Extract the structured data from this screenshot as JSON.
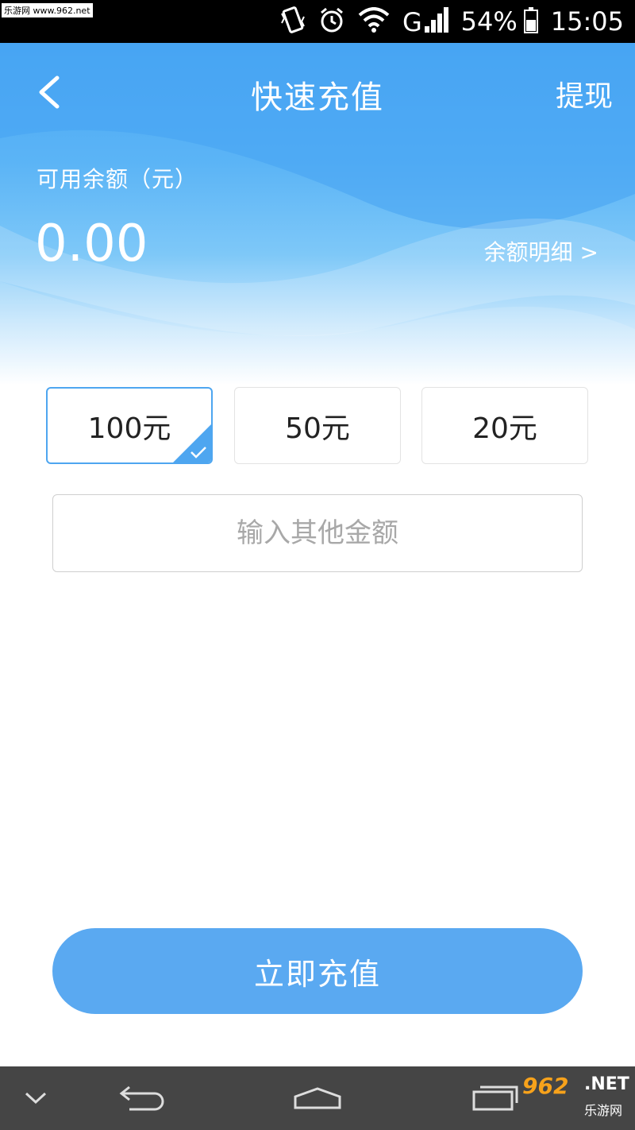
{
  "status_bar": {
    "watermark": "乐游网 www.962.net",
    "battery": "54%",
    "time": "15:05"
  },
  "header": {
    "title": "快速充值",
    "withdraw_label": "提现"
  },
  "balance": {
    "label": "可用余额（元）",
    "value": "0.00",
    "detail_link": "余额明细 >"
  },
  "amounts": [
    {
      "label": "100元",
      "selected": true
    },
    {
      "label": "50元",
      "selected": false
    },
    {
      "label": "20元",
      "selected": false
    }
  ],
  "other_amount": {
    "placeholder": "输入其他金额",
    "value": ""
  },
  "submit_label": "立即充值",
  "brand": {
    "logo_text": "962",
    "net": ".NET",
    "name": "乐游网"
  },
  "colors": {
    "accent": "#5aa9f1",
    "hero_top": "#4aa8f3",
    "navbar": "#454545"
  }
}
